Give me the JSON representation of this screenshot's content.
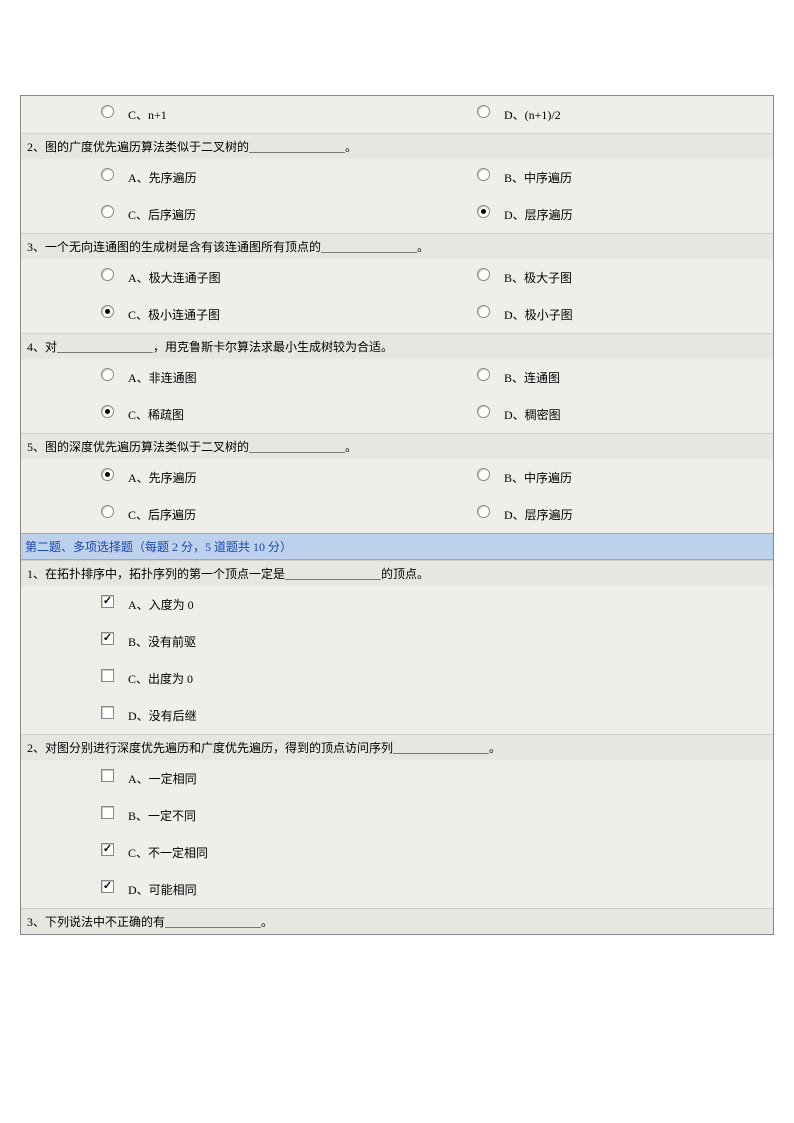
{
  "single": {
    "q1_opts": {
      "c": "C、n+1",
      "d": "D、(n+1)/2"
    },
    "q2": {
      "text": "2、图的广度优先遍历算法类似于二叉树的＿＿＿＿＿＿＿＿。",
      "a": "A、先序遍历",
      "b": "B、中序遍历",
      "c": "C、后序遍历",
      "d": "D、层序遍历"
    },
    "q3": {
      "text": "3、一个无向连通图的生成树是含有该连通图所有顶点的＿＿＿＿＿＿＿＿。",
      "a": "A、极大连通子图",
      "b": "B、极大子图",
      "c": "C、极小连通子图",
      "d": "D、极小子图"
    },
    "q4": {
      "text": "4、对＿＿＿＿＿＿＿＿，用克鲁斯卡尔算法求最小生成树较为合适。",
      "a": "A、非连通图",
      "b": "B、连通图",
      "c": "C、稀疏图",
      "d": "D、稠密图"
    },
    "q5": {
      "text": "5、图的深度优先遍历算法类似于二叉树的＿＿＿＿＿＿＿＿。",
      "a": "A、先序遍历",
      "b": "B、中序遍历",
      "c": "C、后序遍历",
      "d": "D、层序遍历"
    }
  },
  "section2_header": "第二题、多项选择题（每题 2 分，5 道题共 10 分）",
  "multi": {
    "q1": {
      "text": "1、在拓扑排序中，拓扑序列的第一个顶点一定是＿＿＿＿＿＿＿＿的顶点。",
      "a": "A、入度为 0",
      "b": "B、没有前驱",
      "c": "C、出度为 0",
      "d": "D、没有后继"
    },
    "q2": {
      "text": "2、对图分别进行深度优先遍历和广度优先遍历，得到的顶点访问序列＿＿＿＿＿＿＿＿。",
      "a": "A、一定相同",
      "b": "B、一定不同",
      "c": "C、不一定相同",
      "d": "D、可能相同"
    },
    "q3": {
      "text": "3、下列说法中不正确的有＿＿＿＿＿＿＿＿。"
    }
  }
}
